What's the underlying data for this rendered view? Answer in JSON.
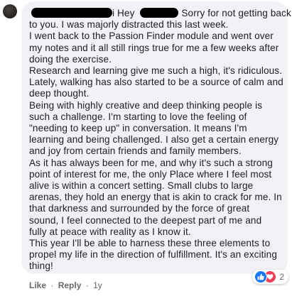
{
  "comment": {
    "greeting_suffix": "i Hey",
    "line1_rest": "Sorry for not getting back",
    "lines": [
      "to you. I was majorly distracted this last week.",
      "I went back to the Passion Finder module and went over",
      "my notes and it all still rings true for me a few weeks after",
      "doing the exercise.",
      "Research and learning give me such a high, it's ridiculous.",
      "Lately, walking has also started to be a source of calm and",
      "deep thought.",
      "Being with highly creative and deep thinking people is",
      "such a challenge. I'm starting to love the feeling of",
      "\"needing to keep up\" in conversation. It means I'm",
      "learning and being challenged. I also get a certain energy",
      "and joy from certain friends and family members.",
      "As it has always been for me, and why it's such a strong",
      "point of interest for me, the only Place where I feel most",
      "alive is within a concert setting. Small clubs to large",
      "arenas, they hold an energy that is akin to crack for me. In",
      "that darkness and surrounded by the force of great",
      "sound, I feel connected to the deepest part of me and",
      "fully at peace with reality as I know it.",
      "This year I'll be able to harness these three elements to",
      "propel my life in the direction of fulfillment. It's an exciting",
      "thing!"
    ]
  },
  "actions": {
    "like": "Like",
    "separator": "·",
    "reply": "Reply",
    "age": "1y"
  },
  "reactions": {
    "icons": [
      "like-icon",
      "love-icon"
    ],
    "count": "2"
  },
  "colors": {
    "bubble": "#f0f2f5",
    "text": "#1c1e21",
    "meta": "#65676b",
    "like": "#1877f2",
    "love": "#f33e58"
  }
}
